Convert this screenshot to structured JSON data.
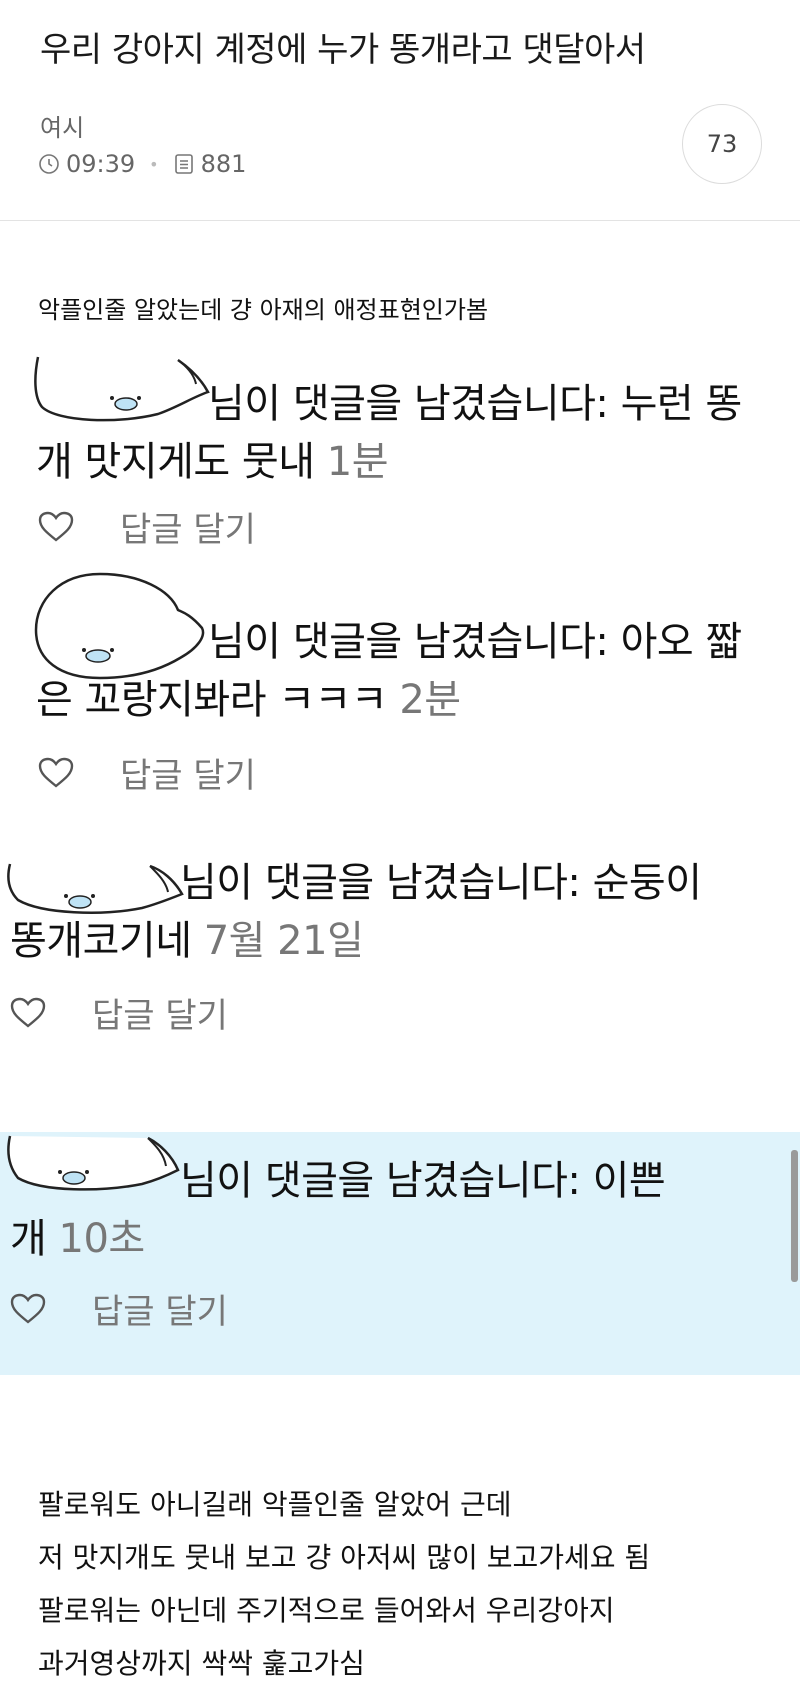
{
  "post": {
    "title": "우리 강아지 계정에 누가 똥개라고 댓달아서",
    "author": "여시",
    "time": "09:39",
    "views": "881",
    "comment_count": "73"
  },
  "intro_text": "악플인줄 알았는데 걍 아재의 애정표현인가봄",
  "notifications": [
    {
      "line1": "님이 댓글을 남겼습니다: 누런 똥",
      "line2": "개 맛지게도 뭇내",
      "time": "1분",
      "reply": "답글 달기"
    },
    {
      "line1": "님이 댓글을 남겼습니다: 아오 짧",
      "line2": "은 꼬랑지봐라 ㅋㅋㅋ",
      "time": "2분",
      "reply": "답글 달기"
    },
    {
      "line1": "님이 댓글을 남겼습니다: 순둥이",
      "line2": "똥개코기네",
      "time": "7월 21일",
      "reply": "답글 달기"
    },
    {
      "line1": "님이 댓글을 남겼습니다: 이쁜",
      "line2": "개",
      "time": "10초",
      "reply": "답글 달기"
    }
  ],
  "outro_lines": [
    "팔로워도 아니길래 악플인줄 알았어 근데",
    "저 맛지개도 뭇내 보고 걍 아저씨 많이 보고가세요 됨",
    "팔로워는 아닌데 주기적으로 들어와서 우리강아지",
    "과거영상까지 싹싹 훑고가심"
  ]
}
